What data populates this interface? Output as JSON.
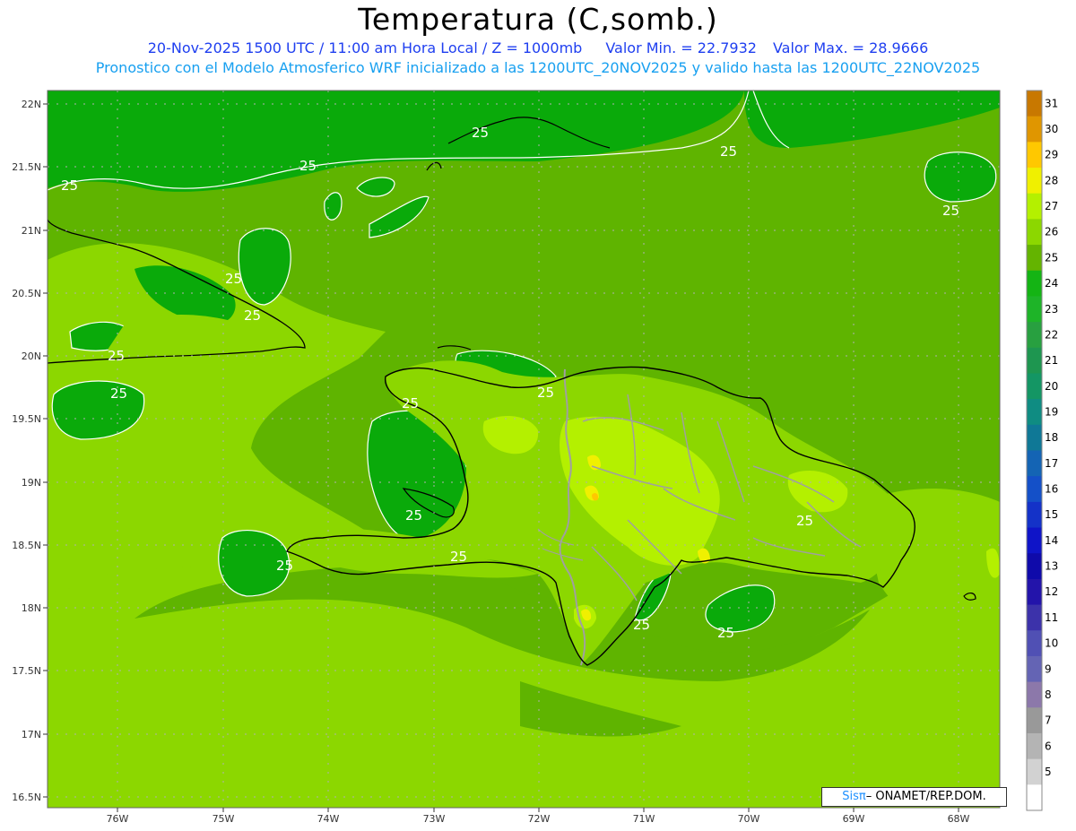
{
  "title": "Temperatura (C,somb.)",
  "subtitle": {
    "timestamp": "20-Nov-2025 1500 UTC / 11:00 am Hora Local / Z = 1000mb",
    "min": "Valor Min. = 22.7932",
    "max": "Valor Max. = 28.9666",
    "line2": "Pronostico con el Modelo Atmosferico WRF inicializado a las 1200UTC_20NOV2025 y valido hasta las  1200UTC_22NOV2025"
  },
  "credit": {
    "brand": "Sisπ",
    "org": "– ONAMET/REP.DOM."
  },
  "axes": {
    "lat_labels": [
      "22N",
      "21.5N",
      "21N",
      "20.5N",
      "20N",
      "19.5N",
      "19N",
      "18.5N",
      "18N",
      "17.5N",
      "17N",
      "16.5N"
    ],
    "lon_labels": [
      "76W",
      "75W",
      "74W",
      "73W",
      "72W",
      "71W",
      "70W",
      "69W",
      "68W"
    ]
  },
  "colorbar": {
    "levels": [
      "31",
      "30",
      "29",
      "28",
      "27",
      "26",
      "25",
      "24",
      "23",
      "22",
      "21",
      "20",
      "19",
      "18",
      "17",
      "16",
      "15",
      "14",
      "13",
      "12",
      "11",
      "10",
      "9",
      "8",
      "7",
      "6",
      "5"
    ],
    "colors": [
      "#c87800",
      "#e09600",
      "#ffc800",
      "#f0f000",
      "#b4f000",
      "#8cd700",
      "#64b400",
      "#14b414",
      "#1eb428",
      "#28a040",
      "#1e9650",
      "#149664",
      "#0f8c82",
      "#0f7896",
      "#1464b4",
      "#1450c8",
      "#1432c8",
      "#0f14c8",
      "#0f0aaa",
      "#2314aa",
      "#3c32aa",
      "#5050b4",
      "#6464b4",
      "#8c78aa",
      "#999999",
      "#b4b4b4",
      "#d2d2d2",
      "#ffffff"
    ]
  },
  "contour_labels": [
    "25",
    "25",
    "25",
    "25",
    "25",
    "25",
    "25",
    "25",
    "25",
    "25",
    "25",
    "25",
    "25",
    "25",
    "25",
    "25",
    "25"
  ],
  "field_colors": {
    "c24": "#0aaa0a",
    "c25": "#5fb400",
    "c26": "#8cd700",
    "c27": "#b4f000",
    "c28": "#f0f000",
    "c29": "#ffc800",
    "coast": "#000000",
    "border": "#a0a0a0",
    "contour": "#ffffff"
  }
}
